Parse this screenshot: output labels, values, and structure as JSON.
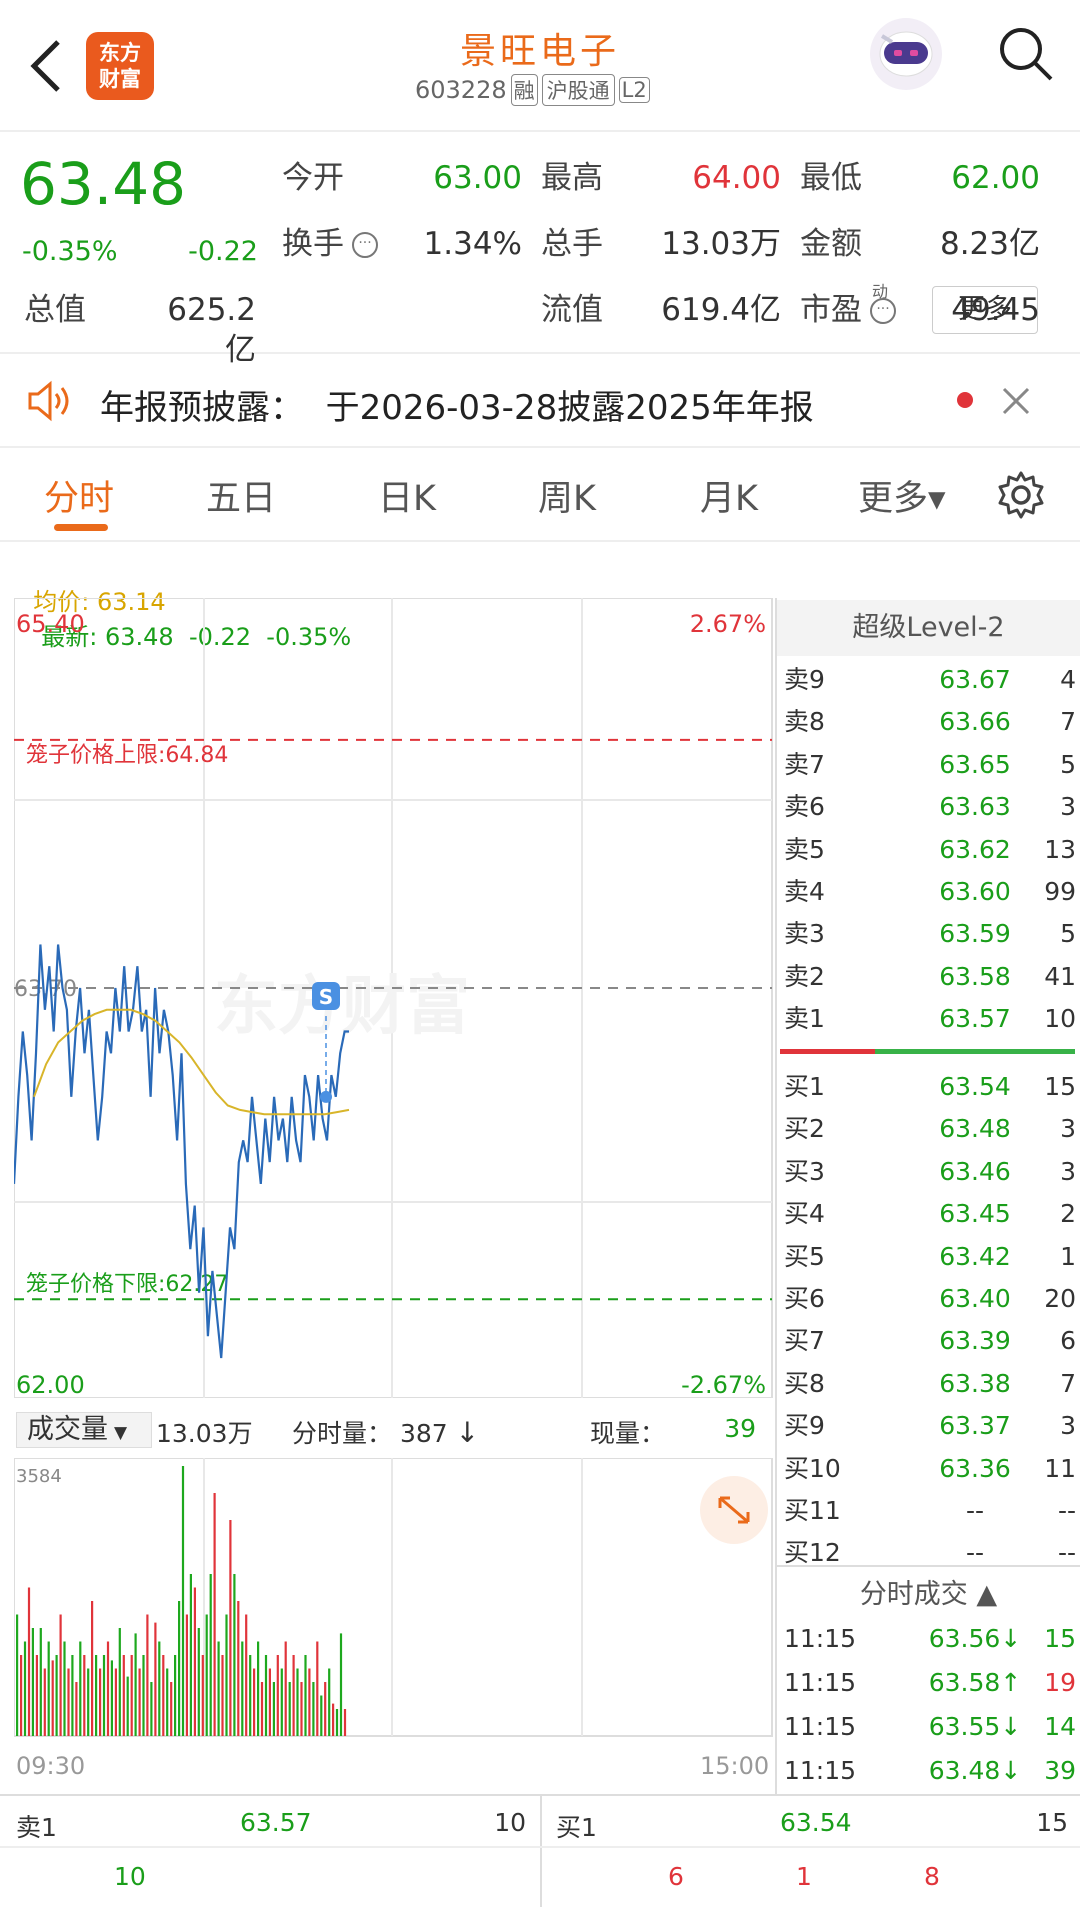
{
  "header": {
    "back_icon": "chevron-left-icon",
    "logo_text": [
      "东方",
      "财富"
    ],
    "stock_name": "景旺电子",
    "stock_code": "603228",
    "tags": [
      "融",
      "沪股通",
      "L2"
    ],
    "search_icon": "search-icon",
    "mascot_icon": "robot-avatar-icon"
  },
  "quote": {
    "price": "63.48",
    "change_pct": "-0.35%",
    "change": "-0.22",
    "fields": [
      {
        "label": "今开",
        "value": "63.00",
        "color": "green"
      },
      {
        "label": "最高",
        "value": "64.00",
        "color": "red"
      },
      {
        "label": "最低",
        "value": "62.00",
        "color": "green"
      },
      {
        "label": "换手",
        "value": "1.34%",
        "color": "dark"
      },
      {
        "label": "总手",
        "value": "13.03万",
        "color": "dark"
      },
      {
        "label": "金额",
        "value": "8.23亿",
        "color": "dark"
      },
      {
        "label": "总值",
        "value": "625.2亿",
        "color": "dark"
      },
      {
        "label": "流值",
        "value": "619.4亿",
        "color": "dark"
      },
      {
        "label": "市盈",
        "value": "49.45",
        "color": "dark",
        "superscript": "动"
      }
    ],
    "more_button": "更多"
  },
  "notice": {
    "icon": "speaker-icon",
    "text": "年报预披露：  于2026-03-28披露2025年年报",
    "close_icon": "close-icon"
  },
  "tabs": {
    "items": [
      "分时",
      "五日",
      "日K",
      "周K",
      "月K",
      "更多▾"
    ],
    "active": 0,
    "settings_icon": "gear-icon"
  },
  "legend": {
    "avg_label": "均价: 63.14",
    "latest_label": "最新: 63.48  -0.22  -0.35%"
  },
  "chart": {
    "y_max_label": "65.40",
    "y_min_label": "62.00",
    "pct_max": "2.67%",
    "pct_min": "-2.67%",
    "prev_close_label": "63.70",
    "watermark": "东方财富",
    "upper_limit_label": "笼子价格上限:64.84",
    "lower_limit_label": "笼子价格下限:62.27",
    "marker_icon": "s-marker-icon",
    "marker_letter": "S"
  },
  "chart_data": {
    "type": "line",
    "title": "",
    "ylim": [
      62.0,
      65.4
    ],
    "prev_close": 63.7,
    "upper_limit": 64.84,
    "lower_limit": 62.27,
    "x_range": [
      "09:30",
      "15:00"
    ],
    "series": [
      {
        "name": "最新",
        "color": "#2a6ab8",
        "values": [
          62.8,
          63.2,
          63.5,
          63.3,
          63.0,
          63.4,
          63.9,
          63.6,
          63.8,
          63.5,
          63.9,
          63.7,
          63.6,
          63.2,
          63.5,
          63.7,
          63.4,
          63.6,
          63.3,
          63.0,
          63.2,
          63.5,
          63.4,
          63.7,
          63.5,
          63.8,
          63.5,
          63.6,
          63.8,
          63.5,
          63.6,
          63.2,
          63.7,
          63.4,
          63.6,
          63.5,
          63.3,
          63.0,
          63.4,
          62.8,
          62.5,
          62.7,
          62.3,
          62.6,
          62.1,
          62.4,
          62.2,
          62.0,
          62.3,
          62.6,
          62.5,
          62.9,
          63.0,
          62.9,
          63.2,
          63.0,
          62.8,
          63.1,
          62.9,
          63.2,
          63.0,
          63.1,
          62.9,
          63.2,
          63.0,
          62.9,
          63.3,
          63.2,
          63.0,
          63.3,
          63.1,
          63.0,
          63.3,
          63.2,
          63.4,
          63.5,
          63.5
        ]
      },
      {
        "name": "均价",
        "color": "#d8b52a",
        "values": [
          63.2,
          63.35,
          63.45,
          63.5,
          63.55,
          63.58,
          63.6,
          63.6,
          63.6,
          63.58,
          63.55,
          63.5,
          63.45,
          63.38,
          63.3,
          63.22,
          63.16,
          63.14,
          63.13,
          63.12,
          63.12,
          63.12,
          63.12,
          63.12,
          63.12,
          63.13,
          63.14
        ]
      }
    ]
  },
  "volume": {
    "selector": "成交量",
    "total": "13.03万",
    "period_label": "分时量：",
    "period_value": "387",
    "now_label": "现量：",
    "now_value": "39",
    "max_label": "3584",
    "expand_icon": "expand-arrows-icon",
    "time_start": "09:30",
    "time_end": "15:00"
  },
  "volume_data": {
    "type": "bar",
    "values": [
      {
        "v": 0.45,
        "c": "g"
      },
      {
        "v": 0.3,
        "c": "r"
      },
      {
        "v": 0.35,
        "c": "g"
      },
      {
        "v": 0.55,
        "c": "r"
      },
      {
        "v": 0.4,
        "c": "g"
      },
      {
        "v": 0.3,
        "c": "r"
      },
      {
        "v": 0.4,
        "c": "g"
      },
      {
        "v": 0.25,
        "c": "r"
      },
      {
        "v": 0.35,
        "c": "g"
      },
      {
        "v": 0.28,
        "c": "r"
      },
      {
        "v": 0.3,
        "c": "g"
      },
      {
        "v": 0.45,
        "c": "r"
      },
      {
        "v": 0.35,
        "c": "g"
      },
      {
        "v": 0.25,
        "c": "r"
      },
      {
        "v": 0.3,
        "c": "g"
      },
      {
        "v": 0.2,
        "c": "r"
      },
      {
        "v": 0.35,
        "c": "g"
      },
      {
        "v": 0.3,
        "c": "r"
      },
      {
        "v": 0.25,
        "c": "g"
      },
      {
        "v": 0.5,
        "c": "r"
      },
      {
        "v": 0.3,
        "c": "g"
      },
      {
        "v": 0.25,
        "c": "r"
      },
      {
        "v": 0.3,
        "c": "g"
      },
      {
        "v": 0.35,
        "c": "r"
      },
      {
        "v": 0.28,
        "c": "g"
      },
      {
        "v": 0.25,
        "c": "r"
      },
      {
        "v": 0.4,
        "c": "g"
      },
      {
        "v": 0.3,
        "c": "r"
      },
      {
        "v": 0.22,
        "c": "g"
      },
      {
        "v": 0.3,
        "c": "r"
      },
      {
        "v": 0.38,
        "c": "g"
      },
      {
        "v": 0.25,
        "c": "r"
      },
      {
        "v": 0.3,
        "c": "g"
      },
      {
        "v": 0.45,
        "c": "r"
      },
      {
        "v": 0.2,
        "c": "g"
      },
      {
        "v": 0.42,
        "c": "r"
      },
      {
        "v": 0.35,
        "c": "g"
      },
      {
        "v": 0.3,
        "c": "r"
      },
      {
        "v": 0.25,
        "c": "g"
      },
      {
        "v": 0.2,
        "c": "r"
      },
      {
        "v": 0.3,
        "c": "g"
      },
      {
        "v": 0.5,
        "c": "g"
      },
      {
        "v": 1.0,
        "c": "g"
      },
      {
        "v": 0.45,
        "c": "r"
      },
      {
        "v": 0.6,
        "c": "g"
      },
      {
        "v": 0.55,
        "c": "r"
      },
      {
        "v": 0.4,
        "c": "g"
      },
      {
        "v": 0.3,
        "c": "r"
      },
      {
        "v": 0.45,
        "c": "g"
      },
      {
        "v": 0.6,
        "c": "g"
      },
      {
        "v": 0.9,
        "c": "r"
      },
      {
        "v": 0.35,
        "c": "g"
      },
      {
        "v": 0.3,
        "c": "r"
      },
      {
        "v": 0.45,
        "c": "g"
      },
      {
        "v": 0.8,
        "c": "r"
      },
      {
        "v": 0.6,
        "c": "g"
      },
      {
        "v": 0.5,
        "c": "r"
      },
      {
        "v": 0.35,
        "c": "g"
      },
      {
        "v": 0.45,
        "c": "r"
      },
      {
        "v": 0.3,
        "c": "g"
      },
      {
        "v": 0.25,
        "c": "r"
      },
      {
        "v": 0.35,
        "c": "g"
      },
      {
        "v": 0.2,
        "c": "r"
      },
      {
        "v": 0.3,
        "c": "g"
      },
      {
        "v": 0.25,
        "c": "r"
      },
      {
        "v": 0.2,
        "c": "g"
      },
      {
        "v": 0.3,
        "c": "r"
      },
      {
        "v": 0.25,
        "c": "g"
      },
      {
        "v": 0.35,
        "c": "r"
      },
      {
        "v": 0.2,
        "c": "g"
      },
      {
        "v": 0.3,
        "c": "r"
      },
      {
        "v": 0.25,
        "c": "g"
      },
      {
        "v": 0.2,
        "c": "r"
      },
      {
        "v": 0.3,
        "c": "g"
      },
      {
        "v": 0.25,
        "c": "r"
      },
      {
        "v": 0.2,
        "c": "g"
      },
      {
        "v": 0.35,
        "c": "r"
      },
      {
        "v": 0.15,
        "c": "g"
      },
      {
        "v": 0.2,
        "c": "r"
      },
      {
        "v": 0.25,
        "c": "g"
      },
      {
        "v": 0.12,
        "c": "r"
      },
      {
        "v": 0.1,
        "c": "g"
      },
      {
        "v": 0.38,
        "c": "g"
      },
      {
        "v": 0.1,
        "c": "r"
      }
    ]
  },
  "order_book": {
    "title": "超级Level-2",
    "asks": [
      [
        "卖9",
        "63.67",
        "4"
      ],
      [
        "卖8",
        "63.66",
        "7"
      ],
      [
        "卖7",
        "63.65",
        "5"
      ],
      [
        "卖6",
        "63.63",
        "3"
      ],
      [
        "卖5",
        "63.62",
        "13"
      ],
      [
        "卖4",
        "63.60",
        "99"
      ],
      [
        "卖3",
        "63.59",
        "5"
      ],
      [
        "卖2",
        "63.58",
        "41"
      ],
      [
        "卖1",
        "63.57",
        "10"
      ]
    ],
    "bids": [
      [
        "买1",
        "63.54",
        "15"
      ],
      [
        "买2",
        "63.48",
        "3"
      ],
      [
        "买3",
        "63.46",
        "3"
      ],
      [
        "买4",
        "63.45",
        "2"
      ],
      [
        "买5",
        "63.42",
        "1"
      ],
      [
        "买6",
        "63.40",
        "20"
      ],
      [
        "买7",
        "63.39",
        "6"
      ],
      [
        "买8",
        "63.38",
        "7"
      ],
      [
        "买9",
        "63.37",
        "3"
      ],
      [
        "买10",
        "63.36",
        "11"
      ],
      [
        "买11",
        "--",
        "--"
      ],
      [
        "买12",
        "--",
        "--"
      ]
    ],
    "ticks_title": "分时成交 ▲",
    "ticks": [
      [
        "11:15",
        "63.56↓",
        "15",
        "green"
      ],
      [
        "11:15",
        "63.58↑",
        "19",
        "red"
      ],
      [
        "11:15",
        "63.55↓",
        "14",
        "green"
      ],
      [
        "11:15",
        "63.48↓",
        "39",
        "green"
      ]
    ]
  },
  "bottom": {
    "ask_label": "卖1",
    "ask_price": "63.57",
    "ask_vol": "10",
    "bid_label": "买1",
    "bid_price": "63.54",
    "bid_vol": "15",
    "ask_queue": [
      "10"
    ],
    "bid_queue": [
      "6",
      "1",
      "8"
    ]
  }
}
